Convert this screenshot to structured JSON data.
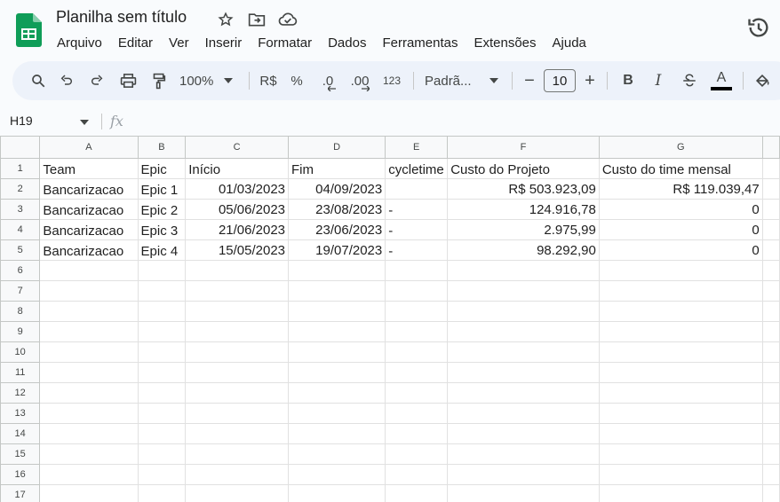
{
  "app": {
    "title": "Planilha sem título",
    "menu": [
      "Arquivo",
      "Editar",
      "Ver",
      "Inserir",
      "Formatar",
      "Dados",
      "Ferramentas",
      "Extensões",
      "Ajuda"
    ]
  },
  "toolbar": {
    "zoom": "100%",
    "currency": "R$",
    "percent": "%",
    "dec_decrease": ".0",
    "dec_increase": ".00",
    "more_formats": "123",
    "font": "Padrã...",
    "font_size": "10",
    "minus": "−",
    "plus": "+",
    "bold": "B",
    "italic": "I",
    "text_color": "A"
  },
  "formula_bar": {
    "cell_ref": "H19",
    "fx": "fx"
  },
  "sheet": {
    "columns": [
      "A",
      "B",
      "C",
      "D",
      "E",
      "F",
      "G"
    ],
    "row_numbers": [
      "1",
      "2",
      "3",
      "4",
      "5",
      "6",
      "7",
      "8",
      "9",
      "10",
      "11",
      "12",
      "13",
      "14",
      "15",
      "16",
      "17"
    ],
    "rows": [
      [
        "Team",
        "Epic",
        "Início",
        "Fim",
        "cycletime",
        "Custo do Projeto",
        "Custo do time mensal"
      ],
      [
        "Bancarizacao",
        "Epic 1",
        "01/03/2023",
        "04/09/2023",
        "",
        "R$ 503.923,09",
        "R$ 119.039,47"
      ],
      [
        "Bancarizacao",
        "Epic 2",
        "05/06/2023",
        "23/08/2023",
        "-",
        "124.916,78",
        "0"
      ],
      [
        "Bancarizacao",
        "Epic 3",
        "21/06/2023",
        "23/06/2023",
        "-",
        "2.975,99",
        "0"
      ],
      [
        "Bancarizacao",
        "Epic 4",
        "15/05/2023",
        "19/07/2023",
        "-",
        "98.292,90",
        "0"
      ]
    ]
  },
  "colors": {
    "brand_green": "#0f9d58",
    "toolbar_bg": "#edf2fa"
  }
}
